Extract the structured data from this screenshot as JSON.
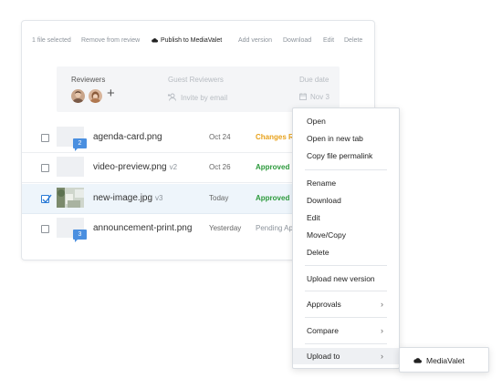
{
  "toolbar": {
    "selection_count": "1 file selected",
    "remove": "Remove from review",
    "publish": "Publish to MediaValet",
    "add_version": "Add version",
    "download": "Download",
    "edit": "Edit",
    "delete": "Delete"
  },
  "review_panel": {
    "reviewers_label": "Reviewers",
    "guest_label": "Guest Reviewers",
    "due_label": "Due date",
    "invite_placeholder": "Invite by email",
    "due_value": "Nov 3",
    "add_symbol": "+"
  },
  "files": [
    {
      "name": "agenda-card.png",
      "version": "",
      "date": "Oct 24",
      "status": "Changes Re",
      "status_color": "#e8a21c",
      "comments": "2",
      "checked": false
    },
    {
      "name": "video-preview.png",
      "version": "v2",
      "date": "Oct 26",
      "status": "Approved",
      "status_color": "#2c9a3c",
      "comments": "",
      "checked": false
    },
    {
      "name": "new-image.jpg",
      "version": "v3",
      "date": "Today",
      "status": "Approved",
      "status_color": "#2c9a3c",
      "comments": "",
      "checked": true
    },
    {
      "name": "announcement-print.png",
      "version": "",
      "date": "Yesterday",
      "status": "Pending Ap",
      "status_color": "#8d949c",
      "comments": "3",
      "checked": false
    }
  ],
  "context_menu": {
    "open": "Open",
    "open_new_tab": "Open in new tab",
    "copy_permalink": "Copy file permalink",
    "rename": "Rename",
    "download": "Download",
    "edit": "Edit",
    "move_copy": "Move/Copy",
    "delete": "Delete",
    "upload_new_version": "Upload new version",
    "approvals": "Approvals",
    "compare": "Compare",
    "upload_to": "Upload to",
    "chevron": "›"
  },
  "submenu": {
    "mediavalet": "MediaValet"
  },
  "colors": {
    "accent": "#4a8fe0",
    "approved": "#2c9a3c",
    "changes": "#e8a21c"
  }
}
